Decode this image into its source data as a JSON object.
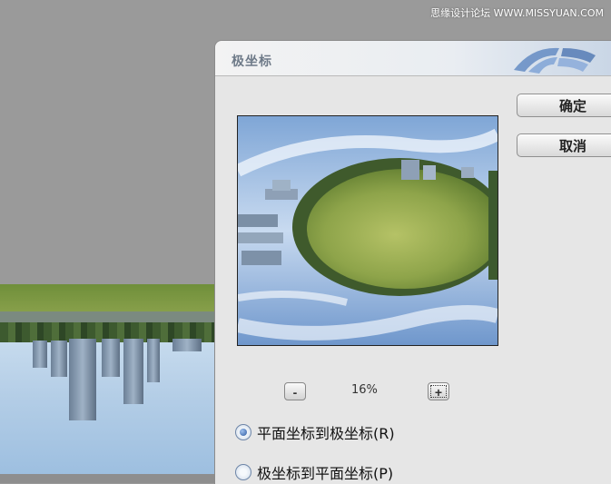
{
  "watermark": "思缘设计论坛 WWW.MISSYUAN.COM",
  "dialog": {
    "title": "极坐标",
    "ok_label": "确定",
    "cancel_label": "取消",
    "zoom_minus": "-",
    "zoom_plus": "+",
    "zoom_level": "16%",
    "options": [
      {
        "label": "平面坐标到极坐标(R)",
        "checked": true
      },
      {
        "label": "极坐标到平面坐标(P)",
        "checked": false
      }
    ]
  },
  "colors": {
    "accent": "#2b5aa0",
    "dialog_bg": "#e6e6e6",
    "workspace_bg": "#9a9a9a"
  }
}
